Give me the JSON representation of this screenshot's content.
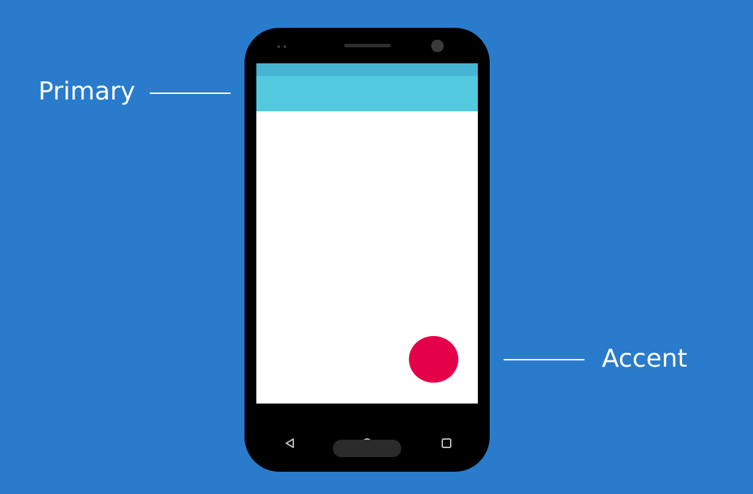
{
  "labels": {
    "primary": "Primary",
    "accent": "Accent"
  },
  "colors": {
    "background": "#2A7BCB",
    "primary": "#53C9DF",
    "primary_dark": "#46B4D2",
    "accent": "#E5004A",
    "phone_body": "#000000",
    "screen": "#FFFFFF",
    "label_text": "#FFFFFF"
  },
  "icons": {
    "nav_back": "back-triangle-icon",
    "nav_home": "home-circle-icon",
    "nav_recent": "recent-apps-square-icon"
  }
}
